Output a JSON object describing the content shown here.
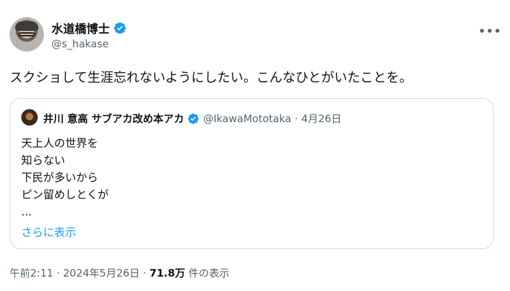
{
  "author": {
    "display_name": "水道橋博士",
    "handle": "@s_hakase"
  },
  "tweet": {
    "text": "スクショして生涯忘れないようにしたい。こんなひとがいたことを。"
  },
  "quoted_tweet": {
    "display_name": "井川 意高 サブアカ改め本アカ",
    "handle": "@IkawaMototaka",
    "separator": "·",
    "date": "4月26日",
    "lines": [
      "天上人の世界を",
      "知らない",
      "下民が多いから",
      "ピン留めしとくが",
      "..."
    ],
    "show_more": "さらに表示"
  },
  "meta": {
    "time": "午前2:11",
    "sep1": " · ",
    "date": "2024年5月26日",
    "sep2": " · ",
    "views": "71.8万",
    "views_label": " 件の表示"
  },
  "icons": {
    "more": "more-horizontal-icon",
    "verified": "verified-badge-icon"
  },
  "colors": {
    "accent": "#1d9bf0",
    "text": "#0f1419",
    "secondary": "#536471",
    "border": "#cfd9de"
  }
}
